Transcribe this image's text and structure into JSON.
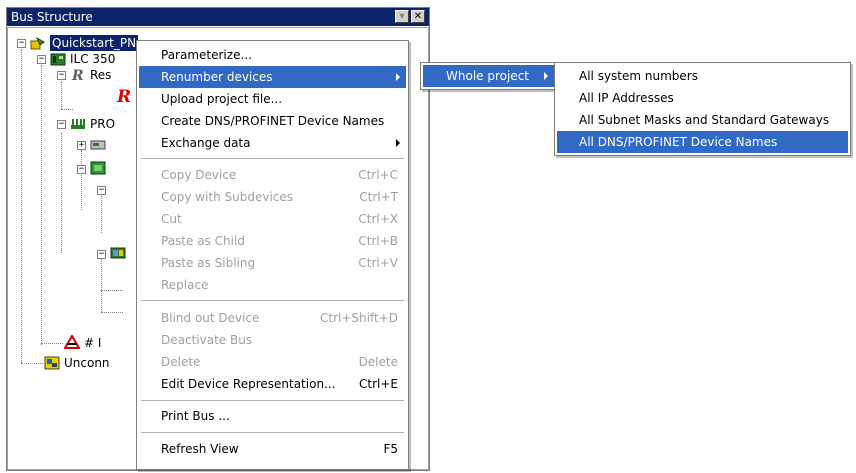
{
  "panel": {
    "title": "Bus Structure",
    "minimize_glyph": "▾",
    "close_glyph": "✕"
  },
  "tree": {
    "root": "Quickstart_PN",
    "ilc": "ILC 350",
    "res": "Res",
    "profinet": "PRO",
    "hash_node": "# I",
    "unconnected": "Unconn"
  },
  "menu": {
    "items": [
      {
        "label": "Parameterize...",
        "shortcut": "",
        "enabled": true
      },
      {
        "label": "Renumber devices",
        "shortcut": "",
        "enabled": true,
        "submenu": true,
        "highlighted": true
      },
      {
        "label": "Upload project file...",
        "shortcut": "",
        "enabled": true
      },
      {
        "label": "Create DNS/PROFINET Device Names",
        "shortcut": "",
        "enabled": true
      },
      {
        "label": "Exchange data",
        "shortcut": "",
        "enabled": true,
        "submenu": true
      },
      {
        "label": "Copy Device",
        "shortcut": "Ctrl+C",
        "enabled": false
      },
      {
        "label": "Copy with Subdevices",
        "shortcut": "Ctrl+T",
        "enabled": false
      },
      {
        "label": "Cut",
        "shortcut": "Ctrl+X",
        "enabled": false
      },
      {
        "label": "Paste as Child",
        "shortcut": "Ctrl+B",
        "enabled": false
      },
      {
        "label": "Paste as Sibling",
        "shortcut": "Ctrl+V",
        "enabled": false
      },
      {
        "label": "Replace",
        "shortcut": "",
        "enabled": false
      },
      {
        "label": "Blind out Device",
        "shortcut": "Ctrl+Shift+D",
        "enabled": false
      },
      {
        "label": "Deactivate Bus",
        "shortcut": "",
        "enabled": false
      },
      {
        "label": "Delete",
        "shortcut": "Delete",
        "enabled": false
      },
      {
        "label": "Edit Device Representation...",
        "shortcut": "Ctrl+E",
        "enabled": true
      },
      {
        "label": "Print Bus ...",
        "shortcut": "",
        "enabled": true
      },
      {
        "label": "Refresh View",
        "shortcut": "F5",
        "enabled": true
      }
    ]
  },
  "submenu1": {
    "items": [
      {
        "label": "Whole project",
        "highlighted": true,
        "submenu": true
      }
    ]
  },
  "submenu2": {
    "items": [
      {
        "label": "All system numbers",
        "highlighted": false
      },
      {
        "label": "All IP Addresses",
        "highlighted": false
      },
      {
        "label": "All Subnet Masks and Standard Gateways",
        "highlighted": false
      },
      {
        "label": "All DNS/PROFINET Device Names",
        "highlighted": true
      }
    ]
  },
  "colors": {
    "highlight": "#316ac5",
    "titlebar": "#0a246a",
    "disabled_text": "#a0a0a0"
  }
}
